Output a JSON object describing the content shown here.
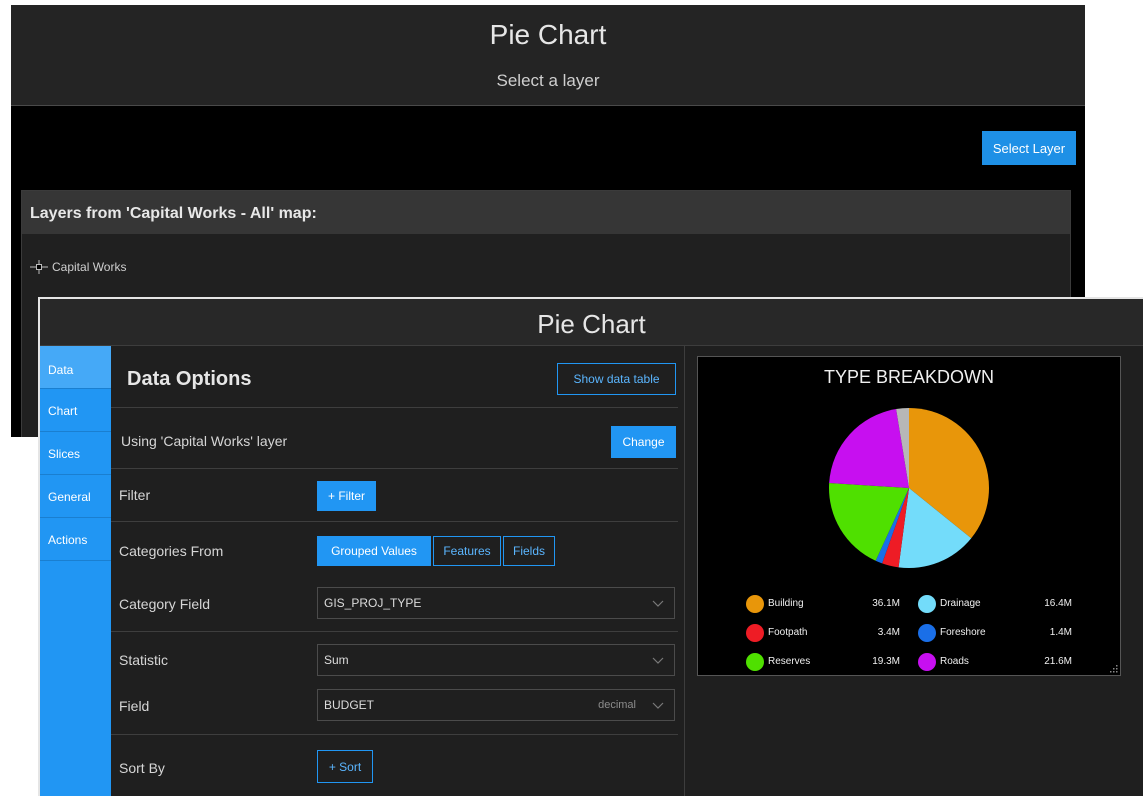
{
  "back_panel": {
    "title": "Pie Chart",
    "subtitle": "Select a layer",
    "select_layer_label": "Select Layer",
    "layers_header": "Layers from 'Capital Works - All' map:",
    "layer_item": "Capital Works"
  },
  "front_panel": {
    "title": "Pie Chart",
    "nav": [
      {
        "label": "Data",
        "active": true
      },
      {
        "label": "Chart"
      },
      {
        "label": "Slices"
      },
      {
        "label": "General"
      },
      {
        "label": "Actions"
      }
    ],
    "data_options": {
      "title": "Data Options",
      "show_table_label": "Show data table",
      "using_layer_text": "Using 'Capital Works' layer",
      "change_label": "Change",
      "filter_label": "Filter",
      "filter_button": "+ Filter",
      "categories_from_label": "Categories From",
      "categories_from_options": [
        "Grouped Values",
        "Features",
        "Fields"
      ],
      "categories_from_selected": "Grouped Values",
      "category_field_label": "Category Field",
      "category_field_value": "GIS_PROJ_TYPE",
      "statistic_label": "Statistic",
      "statistic_value": "Sum",
      "field_label": "Field",
      "field_value": "BUDGET",
      "field_type": "decimal",
      "sort_by_label": "Sort By",
      "sort_button": "+ Sort"
    }
  },
  "chart_data": {
    "type": "pie",
    "title": "TYPE BREAKDOWN",
    "slices": [
      {
        "label": "Building",
        "value": 36.1,
        "display": "36.1M",
        "color": "#e8960a"
      },
      {
        "label": "Drainage",
        "value": 16.4,
        "display": "16.4M",
        "color": "#73dcfa"
      },
      {
        "label": "Footpath",
        "value": 3.4,
        "display": "3.4M",
        "color": "#ee1c25"
      },
      {
        "label": "Foreshore",
        "value": 1.4,
        "display": "1.4M",
        "color": "#1a6fe8"
      },
      {
        "label": "Reserves",
        "value": 19.3,
        "display": "19.3M",
        "color": "#4fe000"
      },
      {
        "label": "Roads",
        "value": 21.6,
        "display": "21.6M",
        "color": "#c70ff0"
      },
      {
        "label": "",
        "value": 2.6,
        "display": "",
        "color": "#b7b7b7",
        "in_legend": false
      }
    ],
    "legend": "bottom"
  }
}
